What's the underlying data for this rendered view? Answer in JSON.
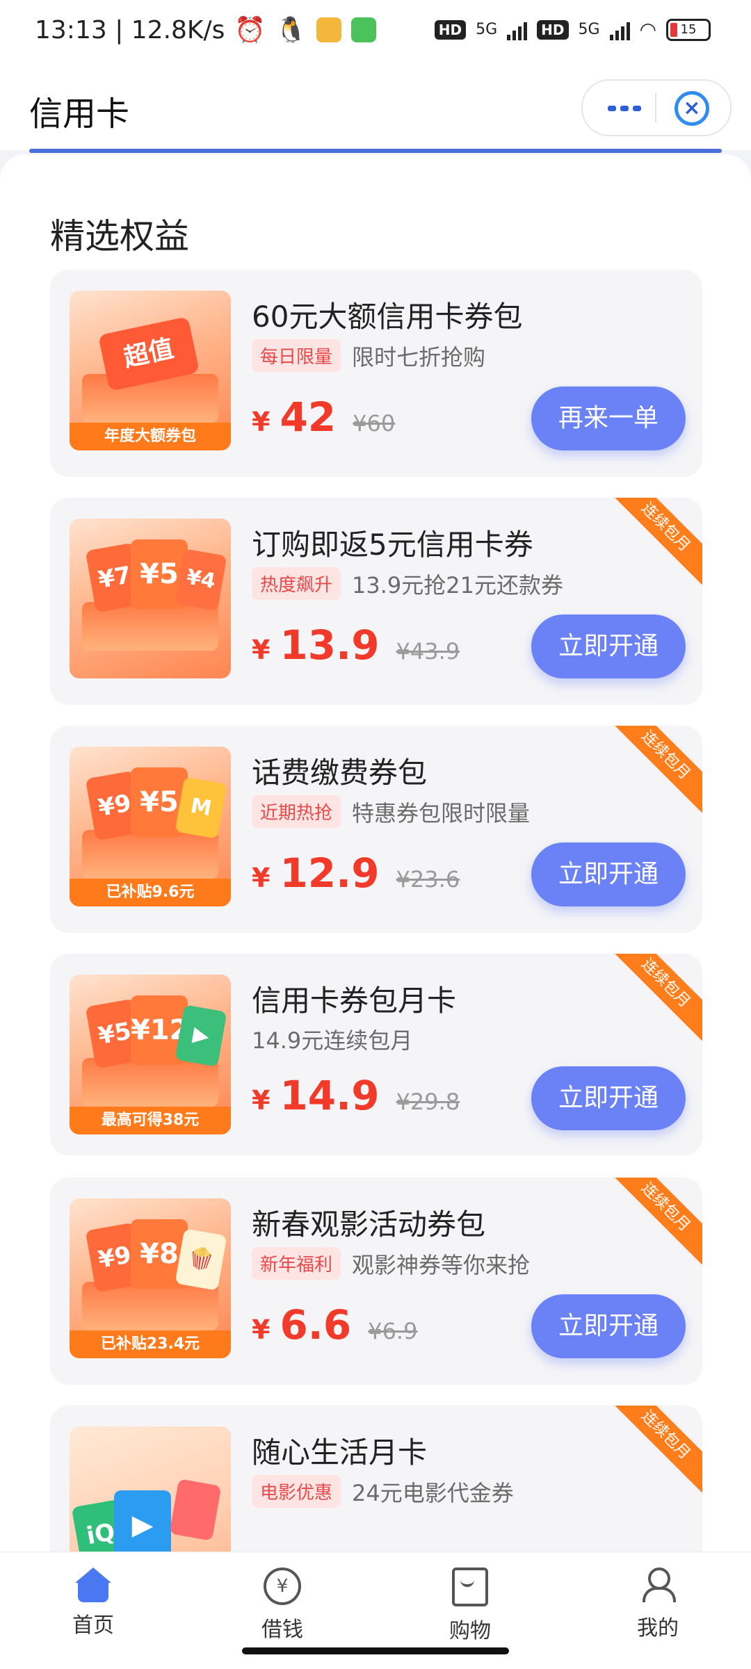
{
  "status_bar": {
    "time_speed": "13:13 | 12.8K/s",
    "network_labels": [
      "HD",
      "5G",
      "HD",
      "5G"
    ],
    "battery": "15"
  },
  "header": {
    "title": "信用卡"
  },
  "section": {
    "title": "精选权益"
  },
  "items": [
    {
      "name": "60元大额信用卡券包",
      "tag": "每日限量",
      "desc": "限时七折抢购",
      "price": "42",
      "original": "¥60",
      "button": "再来一单",
      "thumb_label": "年度大额券包",
      "thumb_sticker": "超值",
      "ribbon": ""
    },
    {
      "name": "订购即返5元信用卡券",
      "tag": "热度飙升",
      "desc": "13.9元抢21元还款券",
      "price": "13.9",
      "original": "¥43.9",
      "button": "立即开通",
      "thumb_label": "",
      "thumb_coupons": [
        "¥7",
        "¥5",
        "¥4"
      ],
      "ribbon": "连续包月"
    },
    {
      "name": "话费缴费券包",
      "tag": "近期热抢",
      "desc": "特惠券包限时限量",
      "price": "12.9",
      "original": "¥23.6",
      "button": "立即开通",
      "thumb_label": "已补贴9.6元",
      "thumb_coupons": [
        "¥9",
        "¥5",
        "M"
      ],
      "ribbon": "连续包月"
    },
    {
      "name": "信用卡券包月卡",
      "tag": "",
      "desc": "14.9元连续包月",
      "price": "14.9",
      "original": "¥29.8",
      "button": "立即开通",
      "thumb_label": "最高可得38元",
      "thumb_coupons": [
        "¥5",
        "¥12",
        "▶"
      ],
      "ribbon": "连续包月"
    },
    {
      "name": "新春观影活动券包",
      "tag": "新年福利",
      "desc": "观影神券等你来抢",
      "price": "6.6",
      "original": "¥6.9",
      "button": "立即开通",
      "thumb_label": "已补贴23.4元",
      "thumb_coupons": [
        "¥9",
        "¥8",
        "🍿"
      ],
      "ribbon": "连续包月"
    },
    {
      "name": "随心生活月卡",
      "tag": "电影优惠",
      "desc": "24元电影代金券",
      "price": "",
      "original": "",
      "button": "",
      "thumb_label": "",
      "thumb_coupons": [
        "iQ",
        "▶",
        ""
      ],
      "ribbon": "连续包月"
    }
  ],
  "nav": [
    {
      "label": "首页",
      "icon": "home-icon"
    },
    {
      "label": "借钱",
      "icon": "yen-icon"
    },
    {
      "label": "购物",
      "icon": "shopping-bag-icon"
    },
    {
      "label": "我的",
      "icon": "profile-icon"
    }
  ],
  "colors": {
    "price_red": "#f23a2b",
    "button_blue": "#6b82f6",
    "tag_bg": "#ffe4e4",
    "ribbon_orange": "#ff7d1a"
  }
}
